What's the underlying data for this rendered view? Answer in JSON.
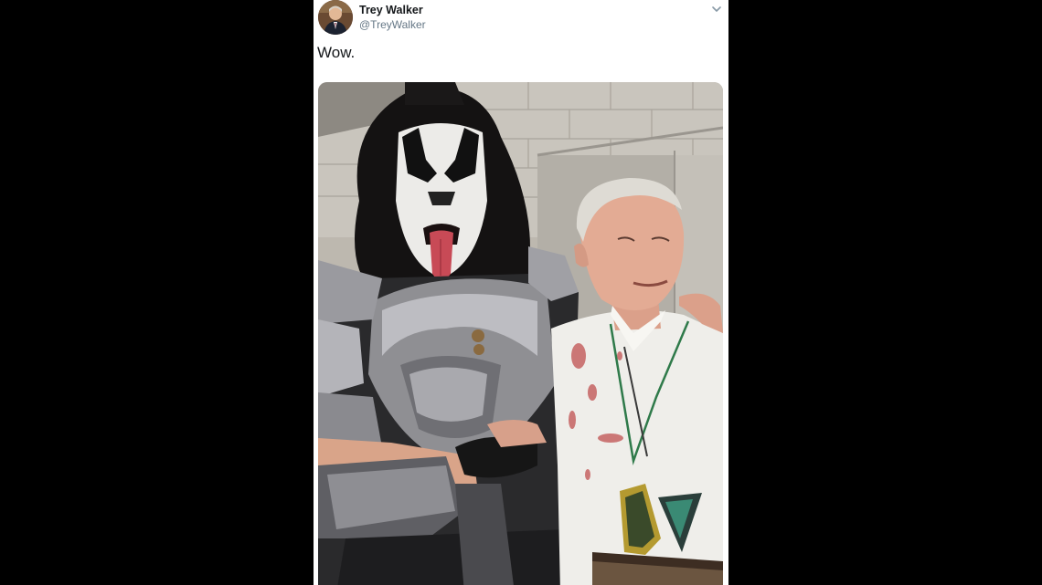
{
  "tweet": {
    "author_name": "Trey Walker",
    "author_handle": "@TreyWalker",
    "text": "Wow.",
    "avatar_icon": "user-avatar",
    "menu_icon": "chevron-down-icon",
    "media_description": "photo"
  },
  "colors": {
    "background": "#000000",
    "card": "#ffffff",
    "name": "#14171a",
    "handle": "#657786"
  }
}
